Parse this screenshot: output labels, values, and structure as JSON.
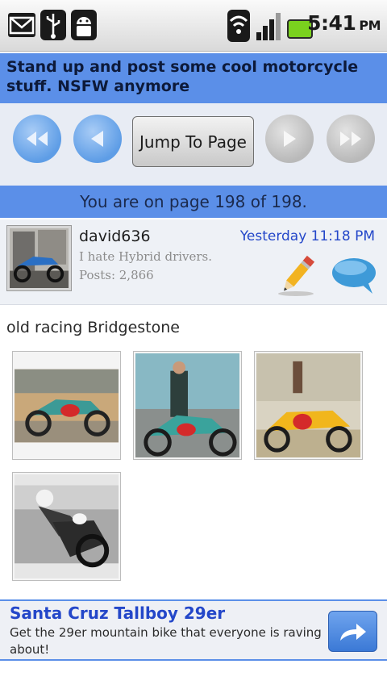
{
  "status_bar": {
    "time": "5:41",
    "ampm": "PM",
    "icons": [
      "gmail-icon",
      "usb-icon",
      "android-debug-icon",
      "wifi-icon",
      "signal-icon",
      "battery-icon"
    ]
  },
  "thread": {
    "title": "Stand up and post some cool motorcycle stuff. NSFW anymore"
  },
  "nav": {
    "jump_label": "Jump To Page",
    "page_indicator": "You are on page 198 of 198."
  },
  "post": {
    "username": "david636",
    "user_title": "I hate Hybrid drivers.",
    "posts": "Posts: 2,866",
    "timestamp": "Yesterday 11:18 PM",
    "text": "old racing Bridgestone",
    "attachments": 4
  },
  "ad": {
    "title": "Santa Cruz Tallboy 29er",
    "body": "Get the 29er mountain bike that everyone is raving about!"
  },
  "colors": {
    "accent_blue": "#5b8fe8",
    "link_blue": "#2447c9"
  }
}
